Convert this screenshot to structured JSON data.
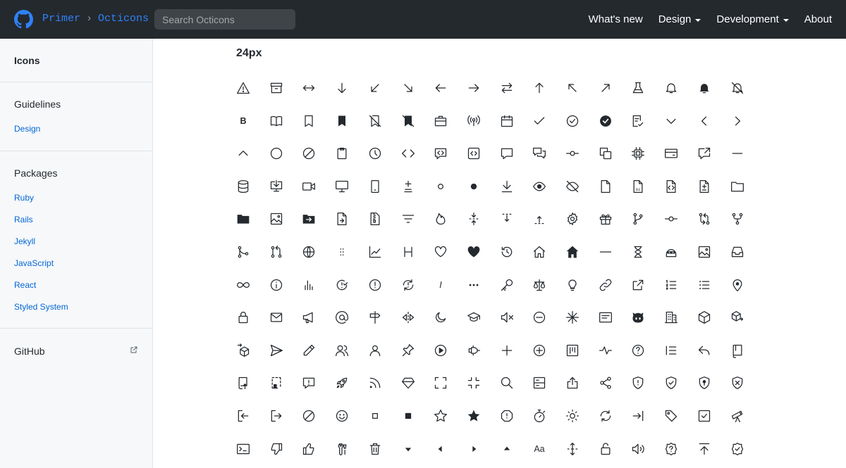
{
  "header": {
    "brand": "Primer",
    "separator": "›",
    "section": "Octicons",
    "search_placeholder": "Search Octicons",
    "nav": [
      {
        "label": "What's new",
        "dropdown": false
      },
      {
        "label": "Design",
        "dropdown": true
      },
      {
        "label": "Development",
        "dropdown": true
      },
      {
        "label": "About",
        "dropdown": false
      }
    ]
  },
  "sidebar": {
    "icons_label": "Icons",
    "guidelines_label": "Guidelines",
    "guidelines_items": [
      "Design"
    ],
    "packages_label": "Packages",
    "packages_items": [
      "Ruby",
      "Rails",
      "Jekyll",
      "JavaScript",
      "React",
      "Styled System"
    ],
    "github_label": "GitHub"
  },
  "main": {
    "heading": "24px",
    "icons": [
      [
        "alert",
        "archive",
        "arrow-both",
        "arrow-down",
        "arrow-down-left",
        "arrow-down-right",
        "arrow-left",
        "arrow-right",
        "arrow-switch",
        "arrow-up",
        "arrow-up-left",
        "arrow-up-right",
        "beaker",
        "bell",
        "bell-fill",
        "bell-slash"
      ],
      [
        "bold",
        "book",
        "bookmark",
        "bookmark-fill",
        "bookmark-slash",
        "bookmark-slash-fill",
        "briefcase",
        "broadcast",
        "calendar",
        "check",
        "check-circle",
        "check-circle-fill",
        "checklist",
        "chevron-down",
        "chevron-left",
        "chevron-right"
      ],
      [
        "chevron-up",
        "circle",
        "circle-slash",
        "clippy",
        "clock",
        "code",
        "code-review",
        "code-square",
        "comment",
        "comment-discussion",
        "commit",
        "copy",
        "cpu",
        "credit-card",
        "cross-reference",
        "dash"
      ],
      [
        "database",
        "desktop-download",
        "device-camera-video",
        "device-desktop",
        "device-mobile",
        "diff",
        "dot",
        "dot-fill",
        "download",
        "eye",
        "eye-closed",
        "file",
        "file-binary",
        "file-code",
        "file-diff",
        "file-directory"
      ],
      [
        "file-directory-fill",
        "file-media",
        "file-submodule",
        "file-symlink-file",
        "file-zip",
        "filter",
        "flame",
        "fold",
        "fold-down",
        "fold-up",
        "gear",
        "gift",
        "git-branch",
        "git-commit",
        "git-compare",
        "git-fork"
      ],
      [
        "git-merge",
        "git-pull-request",
        "globe",
        "grabber",
        "graph",
        "heading",
        "heart",
        "heart-fill",
        "history",
        "home",
        "home-fill",
        "horizontal-rule",
        "hourglass",
        "hubot",
        "image",
        "inbox"
      ],
      [
        "infinity",
        "info",
        "insights",
        "issue-closed",
        "issue-opened",
        "issue-reopened",
        "italic",
        "kebab-horizontal",
        "key",
        "law",
        "light-bulb",
        "link",
        "link-external",
        "list-ordered",
        "list-unordered",
        "location"
      ],
      [
        "lock",
        "mail",
        "megaphone",
        "mention",
        "milestone",
        "mirror",
        "moon",
        "mortar-board",
        "mute",
        "no-entry",
        "north-star",
        "note",
        "octoface",
        "organization",
        "package",
        "package-dependencies"
      ],
      [
        "package-dependents",
        "paper-airplane",
        "pencil",
        "people",
        "person",
        "pin",
        "play",
        "plug",
        "plus",
        "plus-circle",
        "project",
        "pulse",
        "question",
        "quote",
        "reply",
        "repo"
      ],
      [
        "repo-push",
        "repo-template",
        "report",
        "rocket",
        "rss",
        "ruby",
        "screen-full",
        "screen-normal",
        "search",
        "server",
        "share",
        "share-android",
        "shield",
        "shield-check",
        "shield-lock",
        "shield-x"
      ],
      [
        "sign-in",
        "sign-out",
        "skip",
        "smiley",
        "square",
        "square-fill",
        "star",
        "star-fill",
        "stop",
        "stopwatch",
        "sun",
        "sync",
        "tab",
        "tag",
        "tasklist",
        "telescope"
      ],
      [
        "terminal",
        "thumbsdown",
        "thumbsup",
        "tools",
        "trash",
        "triangle-down",
        "triangle-left",
        "triangle-right",
        "triangle-up",
        "typography",
        "unfold",
        "unlock",
        "unmute",
        "unverified",
        "upload",
        "verified"
      ]
    ],
    "typography_glyph": "Aa",
    "bold_glyph": "B",
    "heading_glyph": "H",
    "italic_glyph": "I"
  }
}
